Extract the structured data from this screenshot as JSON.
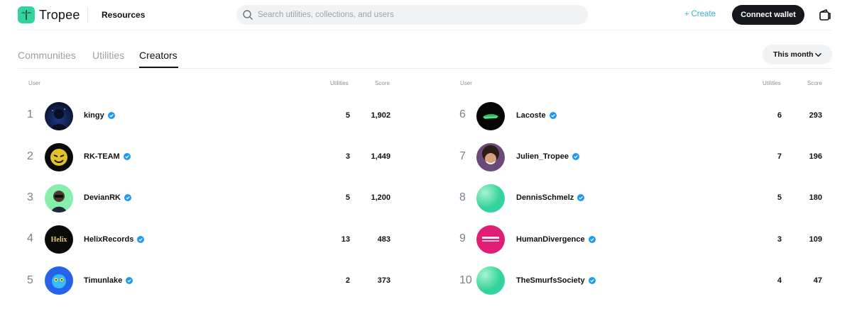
{
  "header": {
    "brand": "Tropee",
    "nav_resources": "Resources",
    "search_placeholder": "Search utilities, collections, and users",
    "create_label": "Create",
    "connect_label": "Connect wallet"
  },
  "tabs": [
    {
      "label": "Communities",
      "active": false
    },
    {
      "label": "Utilities",
      "active": false
    },
    {
      "label": "Creators",
      "active": true
    }
  ],
  "period": {
    "selected": "This month"
  },
  "table": {
    "col_user": "User",
    "col_utilities": "Utilities",
    "col_score": "Score"
  },
  "left_rows": [
    {
      "rank": "1",
      "name": "kingy",
      "utilities": "5",
      "score": "1,902"
    },
    {
      "rank": "2",
      "name": "RK-TEAM",
      "utilities": "3",
      "score": "1,449"
    },
    {
      "rank": "3",
      "name": "DevianRK",
      "utilities": "5",
      "score": "1,200"
    },
    {
      "rank": "4",
      "name": "HelixRecords",
      "utilities": "13",
      "score": "483",
      "avatar_text": "Helix"
    },
    {
      "rank": "5",
      "name": "Timunlake",
      "utilities": "2",
      "score": "373"
    }
  ],
  "right_rows": [
    {
      "rank": "6",
      "name": "Lacoste",
      "utilities": "6",
      "score": "293"
    },
    {
      "rank": "7",
      "name": "Julien_Tropee",
      "utilities": "7",
      "score": "196"
    },
    {
      "rank": "8",
      "name": "DennisSchmelz",
      "utilities": "5",
      "score": "180"
    },
    {
      "rank": "9",
      "name": "HumanDivergence",
      "utilities": "3",
      "score": "109"
    },
    {
      "rank": "10",
      "name": "TheSmurfsSociety",
      "utilities": "4",
      "score": "47"
    }
  ],
  "colors": {
    "brand_green": "#34d39e",
    "create_teal": "#34b5c8",
    "verified_blue": "#1d9bf0",
    "dark_button": "#16181d"
  }
}
